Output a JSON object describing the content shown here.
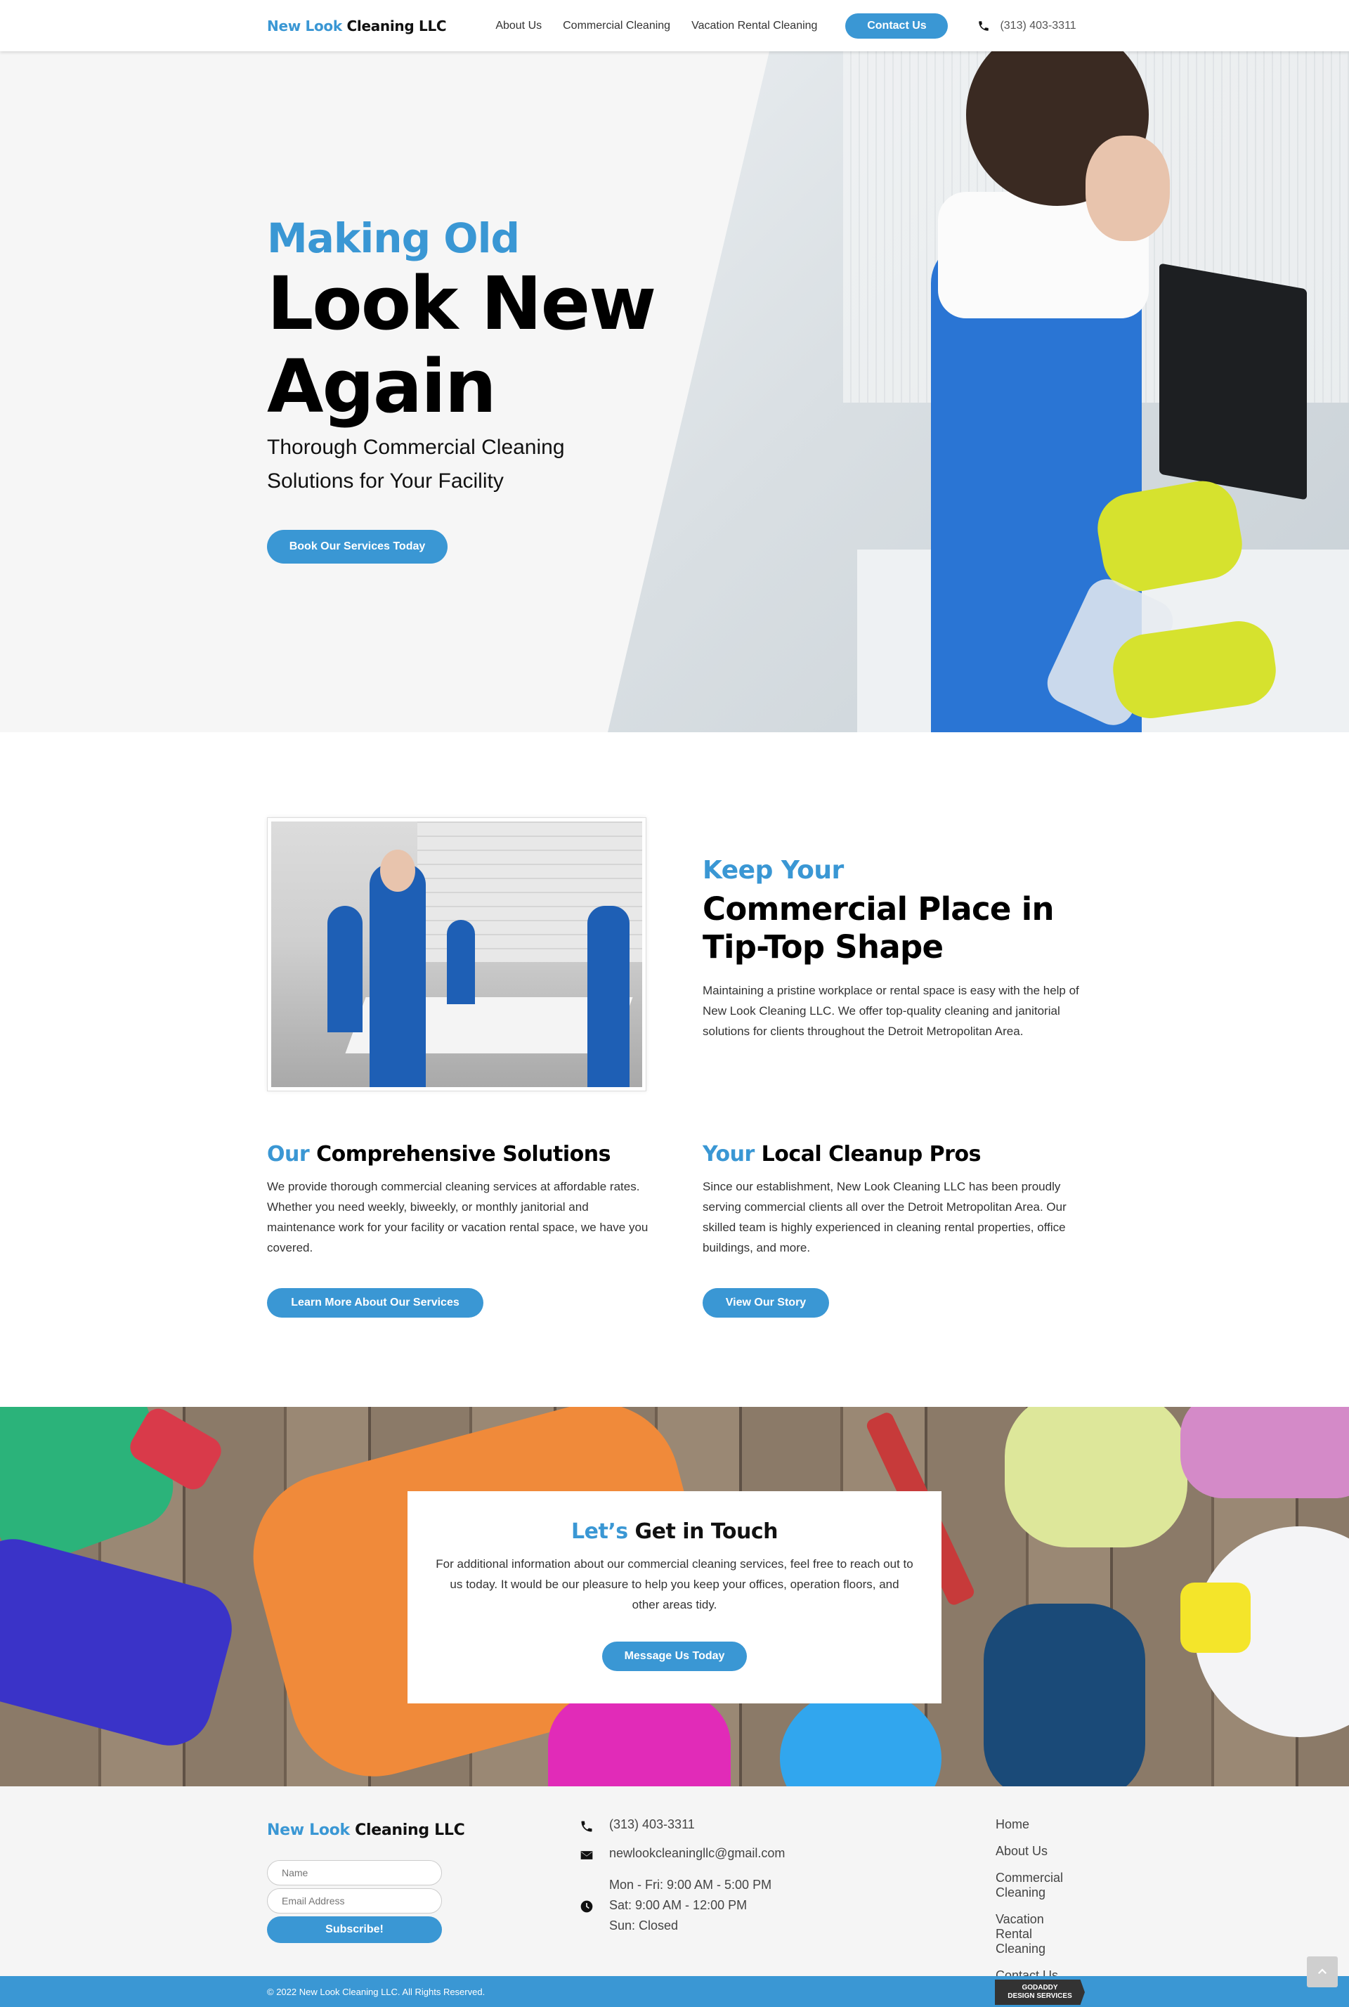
{
  "brand": {
    "part1": "New Look",
    "part2": " Cleaning LLC"
  },
  "nav": {
    "items": [
      "About Us",
      "Commercial Cleaning",
      "Vacation Rental Cleaning"
    ],
    "contact_label": "Contact Us",
    "phone": "(313) 403-3311"
  },
  "hero": {
    "subtitle": "Making Old",
    "title": "Look New Again",
    "description": "Thorough Commercial Cleaning Solutions for Your Facility",
    "button": "Book Our Services Today"
  },
  "about": {
    "sub": "Keep Your",
    "title": "Commercial Place in Tip-Top Shape",
    "text": "Maintaining a pristine workplace or rental space is easy with the help of New Look Cleaning LLC. We offer top-quality cleaning and janitorial solutions for clients throughout the Detroit Metropolitan Area."
  },
  "solutions": {
    "accent": "Our",
    "title": " Comprehensive Solutions",
    "text": "We provide thorough commercial cleaning services at affordable rates. Whether you need weekly, biweekly, or monthly janitorial and maintenance work for your facility or vacation rental space, we have you covered.",
    "button": "Learn More About Our Services"
  },
  "pros": {
    "accent": "Your",
    "title": " Local Cleanup Pros",
    "text": "Since our establishment, New Look Cleaning LLC has been proudly serving commercial clients all over the Detroit Metropolitan Area. Our skilled team is highly experienced in cleaning rental properties, office buildings, and more.",
    "button": "View Our Story"
  },
  "contact": {
    "accent": "Let’s",
    "title": " Get in Touch",
    "text": "For additional information about our commercial cleaning services, feel free to reach out to us today. It would be our pleasure to help you keep your offices, operation floors, and other areas tidy.",
    "button": "Message Us Today"
  },
  "footer": {
    "name_placeholder": "Name",
    "email_placeholder": "Email Address",
    "subscribe": "Subscribe!",
    "phone": "(313) 403-3311",
    "email": "newlookcleaningllc@gmail.com",
    "hours": [
      "Mon - Fri: 9:00 AM - 5:00 PM",
      "Sat: 9:00 AM - 12:00 PM",
      "Sun: Closed"
    ],
    "links": [
      "Home",
      "About Us",
      "Commercial Cleaning",
      "Vacation Rental Cleaning",
      "Contact Us"
    ],
    "copyright": "© 2022 New Look Cleaning LLC. All Rights Reserved.",
    "badge_line1": "GODADDY",
    "badge_line2": "DESIGN SERVICES"
  },
  "colors": {
    "accent": "#3a97d4",
    "footer_bg": "#f5f5f5"
  }
}
